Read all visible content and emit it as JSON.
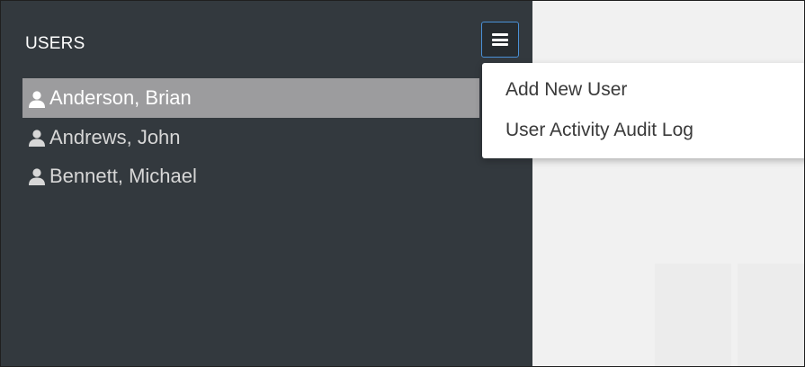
{
  "sidebar": {
    "title": "USERS",
    "menu_icon": "hamburger-menu-icon",
    "users": [
      {
        "name": "Anderson, Brian",
        "selected": true,
        "icon": "user-icon"
      },
      {
        "name": "Andrews, John",
        "selected": false,
        "icon": "user-icon"
      },
      {
        "name": "Bennett, Michael",
        "selected": false,
        "icon": "user-icon"
      }
    ]
  },
  "dropdown": {
    "items": [
      {
        "label": "Add New User"
      },
      {
        "label": "User Activity Audit Log"
      }
    ]
  },
  "colors": {
    "sidebar_bg": "#33393e",
    "selected_bg": "#9c9c9e",
    "menu_border": "#4a90d6",
    "content_bg": "#f1f1f1"
  }
}
